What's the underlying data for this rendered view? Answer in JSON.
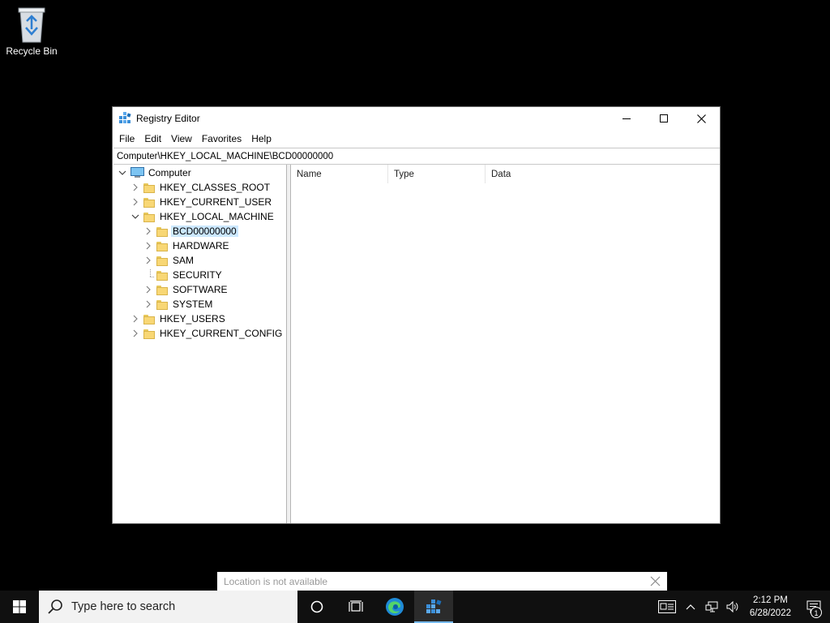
{
  "desktop": {
    "recycle_bin_label": "Recycle Bin"
  },
  "window": {
    "title": "Registry Editor",
    "menu": [
      "File",
      "Edit",
      "View",
      "Favorites",
      "Help"
    ],
    "address": "Computer\\HKEY_LOCAL_MACHINE\\BCD00000000",
    "columns": [
      "Name",
      "Type",
      "Data"
    ],
    "tree": {
      "root": "Computer",
      "hives": {
        "classes_root": "HKEY_CLASSES_ROOT",
        "current_user": "HKEY_CURRENT_USER",
        "local_machine": "HKEY_LOCAL_MACHINE",
        "users": "HKEY_USERS",
        "current_config": "HKEY_CURRENT_CONFIG"
      },
      "local_machine_children": [
        "BCD00000000",
        "HARDWARE",
        "SAM",
        "SECURITY",
        "SOFTWARE",
        "SYSTEM"
      ],
      "selected": "BCD00000000"
    }
  },
  "notification": {
    "text": "Location is not available"
  },
  "taskbar": {
    "search_placeholder": "Type here to search",
    "time": "2:12 PM",
    "date": "6/28/2022",
    "notification_count": "1"
  },
  "colors": {
    "selection": "#cce8ff",
    "folder": "#f8d775",
    "taskbar": "#101010",
    "active_indicator": "#76b9ed"
  }
}
